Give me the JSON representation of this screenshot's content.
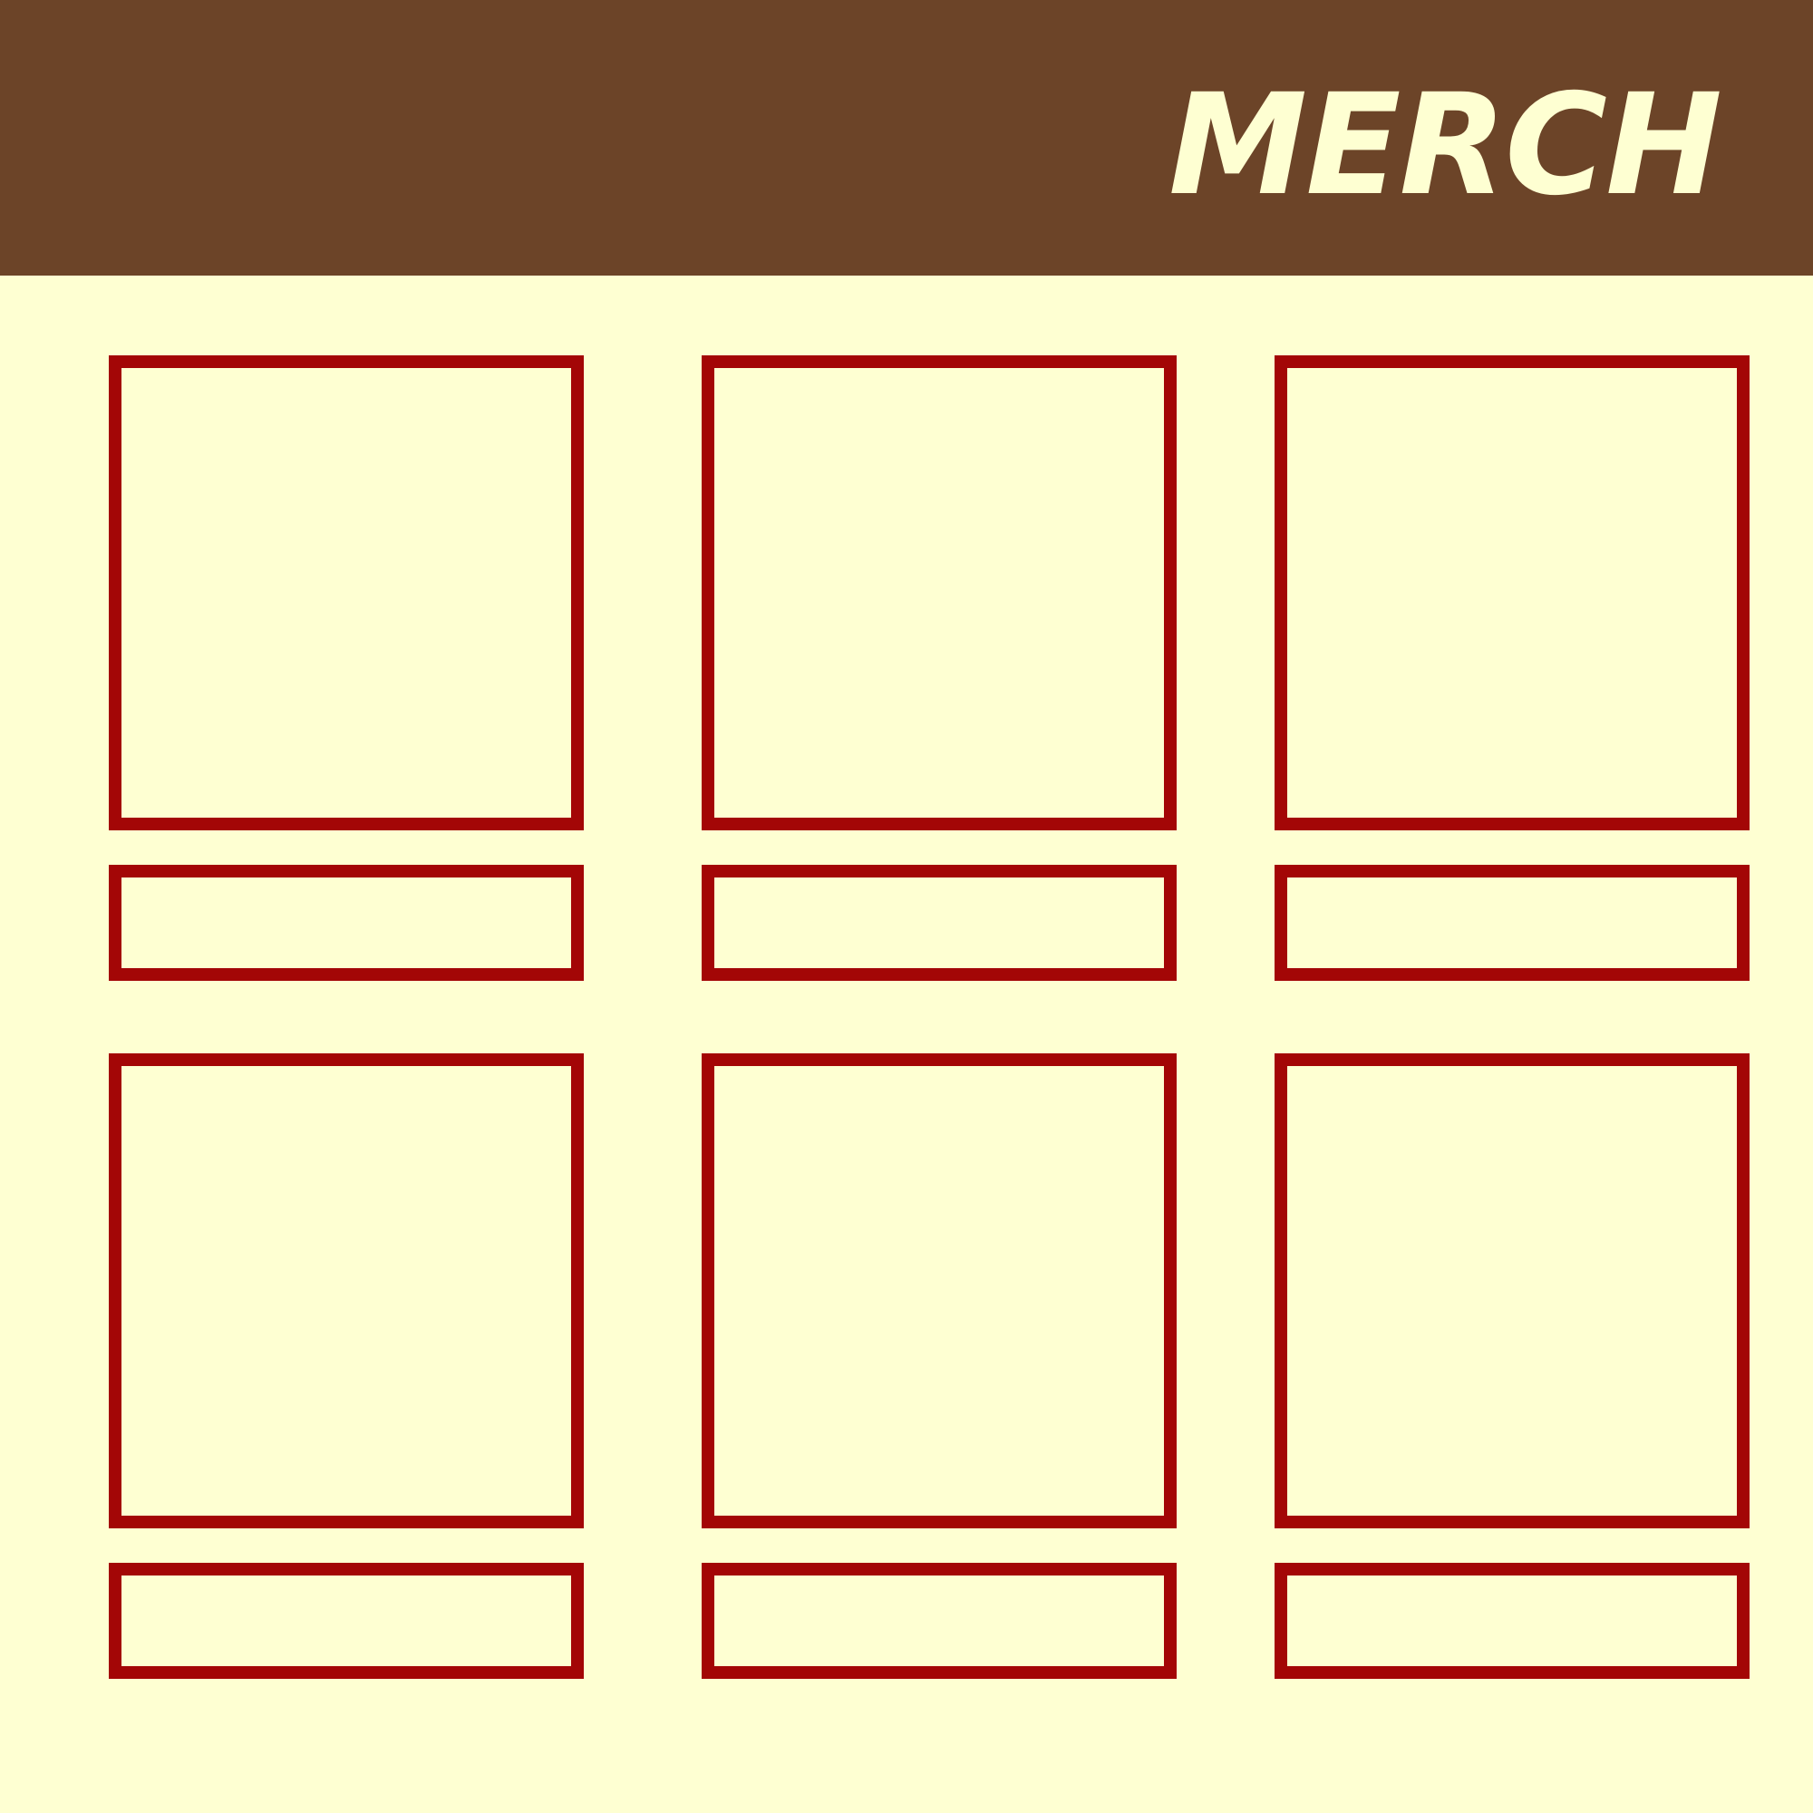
{
  "header": {
    "title": "MERCH"
  },
  "colors": {
    "header_bg": "#6C4428",
    "page_bg": "#FEFFD2",
    "title_text": "#FEFFD2",
    "slot_border": "#A30606"
  }
}
